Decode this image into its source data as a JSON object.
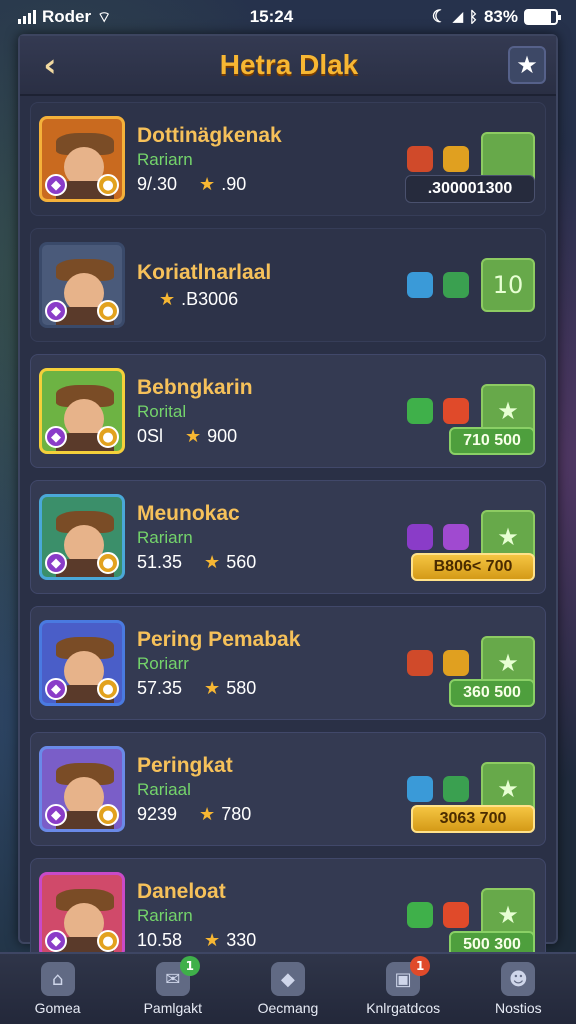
{
  "status_bar": {
    "carrier": "Roder",
    "time": "15:24",
    "battery": "83%",
    "battery_level": 0.83
  },
  "header": {
    "title": "Hetra Dlak",
    "back_icon": "chevron-left-icon",
    "fav_icon": "star-icon"
  },
  "rows": [
    {
      "name": "Dottinägkenak",
      "role": "Rariarn",
      "stat1": "9/.30",
      "stat2": ".90",
      "pill": ".300001300",
      "action": "",
      "pill_style": "coin",
      "frame_color": "#f4b13a",
      "bg_color": "#c96a1f"
    },
    {
      "name": "Koriatlnarlaal",
      "role": "",
      "stat1": "",
      "stat2": ".B3006",
      "pill": "",
      "action": "10",
      "pill_style": "none",
      "frame_color": "#3a4a6a",
      "bg_color": "#4a5a7a"
    },
    {
      "name": "Bebngkarin",
      "role": "Rorital",
      "stat1": "0Sl",
      "stat2": "900",
      "pill": "710 500",
      "action": "★",
      "pill_style": "green",
      "frame_color": "#f4d03a",
      "bg_color": "#6db343"
    },
    {
      "name": "Meunokac",
      "role": "Rariarn",
      "stat1": "51.35",
      "stat2": "560",
      "pill": "B806< 700",
      "action": "★",
      "pill_style": "gold",
      "frame_color": "#4aa8d8",
      "bg_color": "#3b8f6a"
    },
    {
      "name": "Pering Pemabak",
      "role": "Roriarr",
      "stat1": "57.35",
      "stat2": "580",
      "pill": "360 500",
      "action": "★",
      "pill_style": "green",
      "frame_color": "#4a7ae0",
      "bg_color": "#4a5ec8"
    },
    {
      "name": "Peringkat",
      "role": "Rariaal",
      "stat1": "9239",
      "stat2": "780",
      "pill": "3063 700",
      "action": "★",
      "pill_style": "gold",
      "frame_color": "#6a8ae8",
      "bg_color": "#7a5ec8"
    },
    {
      "name": "Daneloat",
      "role": "Rariarn",
      "stat1": "10.58",
      "stat2": "330",
      "pill": "500 300",
      "action": "★",
      "pill_style": "green",
      "frame_color": "#c94ac8",
      "bg_color": "#d04a6a"
    }
  ],
  "bottom_nav": [
    {
      "label": "Gomea",
      "icon": "home-icon",
      "badge": ""
    },
    {
      "label": "Pamlgakt",
      "icon": "chat-icon",
      "badge": "1"
    },
    {
      "label": "Oecmang",
      "icon": "gem-icon",
      "badge": ""
    },
    {
      "label": "Knlrgatdcos",
      "icon": "shop-icon",
      "badge": "1"
    },
    {
      "label": "Nostios",
      "icon": "profile-icon",
      "badge": ""
    }
  ]
}
